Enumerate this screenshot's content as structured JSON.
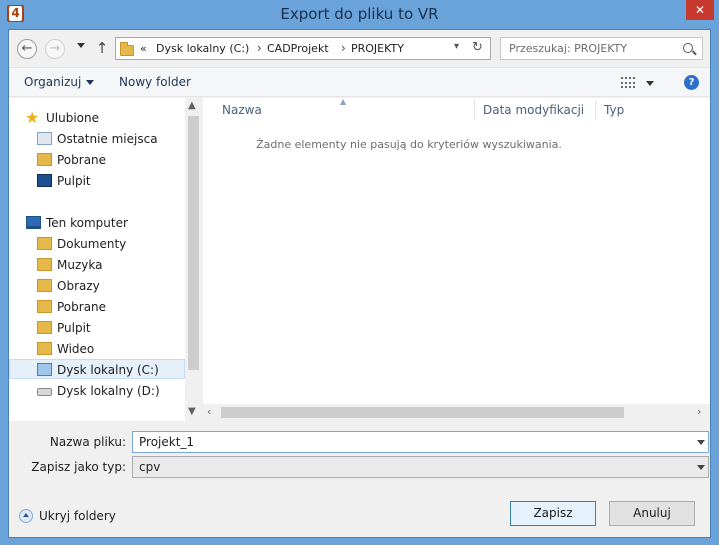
{
  "window": {
    "title": "Export do pliku to VR",
    "app_icon_label": "4",
    "close_label": "✕"
  },
  "nav": {
    "back_icon": "←",
    "forward_icon": "→",
    "up_icon": "↑"
  },
  "address": {
    "overflow": "«",
    "crumbs": [
      "Dysk lokalny (C:)",
      "CADProjekt",
      "PROJEKTY"
    ]
  },
  "search": {
    "placeholder": "Przeszukaj: PROJEKTY"
  },
  "toolbar": {
    "organize_label": "Organizuj",
    "new_folder_label": "Nowy folder",
    "help_label": "?"
  },
  "sidebar": {
    "favorites_label": "Ulubione",
    "favorites": [
      "Ostatnie miejsca",
      "Pobrane",
      "Pulpit"
    ],
    "computer_label": "Ten komputer",
    "computer_items": [
      "Dokumenty",
      "Muzyka",
      "Obrazy",
      "Pobrane",
      "Pulpit",
      "Wideo",
      "Dysk lokalny (C:)",
      "Dysk lokalny (D:)"
    ]
  },
  "file_list": {
    "columns": [
      "Nazwa",
      "Data modyfikacji",
      "Typ"
    ],
    "empty_message": "Żadne elementy nie pasują do kryteriów wyszukiwania."
  },
  "form": {
    "filename_label": "Nazwa pliku:",
    "filename_value": "Projekt_1",
    "type_label": "Zapisz jako typ:",
    "type_value": "cpv"
  },
  "footer": {
    "hide_folders_label": "Ukryj foldery",
    "save_label": "Zapisz",
    "cancel_label": "Anuluj"
  },
  "colors": {
    "frame": "#6aa3d9",
    "close": "#c7392f",
    "accent": "#3c7fb1"
  }
}
